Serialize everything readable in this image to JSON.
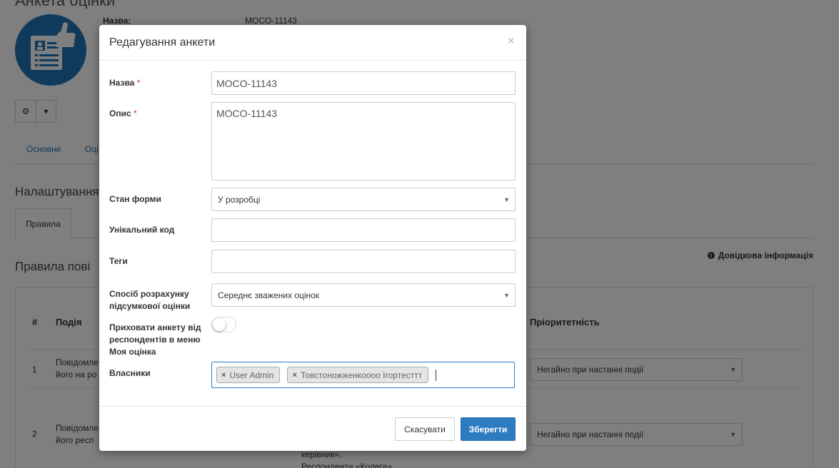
{
  "background": {
    "page_title": "Анкета оцінки",
    "info": {
      "name_label": "Назва:",
      "name_value": "MOCO-11143"
    },
    "tabs": [
      "Основне",
      "Оці"
    ],
    "settings_title": "Налаштування,",
    "subtab": "Правила",
    "rules_title": "Правила пові",
    "help_link": "Довідкова інформація",
    "table_headers": {
      "num": "#",
      "event": "Подія",
      "priority": "Пріоритетність"
    },
    "rows": [
      {
        "num": "1",
        "event_line1": "Повідомле",
        "event_line2": "його на ро",
        "priority": "Негайно при настанні події"
      },
      {
        "num": "2",
        "event_line1": "Повідомле",
        "event_line2": "його респ",
        "extra_line1": "керівник»,",
        "extra_line2": "Респонденти «Колега»",
        "priority": "Негайно при настанні події"
      }
    ]
  },
  "modal": {
    "title": "Редагування анкети",
    "close_symbol": "×",
    "fields": {
      "name": {
        "label": "Назва",
        "required": "*",
        "value": "MOCO-11143"
      },
      "description": {
        "label": "Опис",
        "required": "*",
        "value": "MOCO-11143"
      },
      "form_state": {
        "label": "Стан форми",
        "value": "У розробці"
      },
      "unique_code": {
        "label": "Унікальний код",
        "value": ""
      },
      "tags": {
        "label": "Теги",
        "value": ""
      },
      "calc_method": {
        "label": "Спосіб розрахунку підсумкової оцінки",
        "value": "Середнє зважених оцінок"
      },
      "hide": {
        "label": "Приховати анкету від респондентів в меню Моя оцінка",
        "checked": false
      },
      "owners": {
        "label": "Власники",
        "items": [
          "User Admin",
          "Товстоножженкоооо Ігортесттт"
        ]
      }
    },
    "buttons": {
      "cancel": "Скасувати",
      "save": "Зберегти"
    }
  },
  "colors": {
    "primary": "#2f7bbf",
    "avatar": "#1f74b8",
    "required": "#c9302c"
  }
}
